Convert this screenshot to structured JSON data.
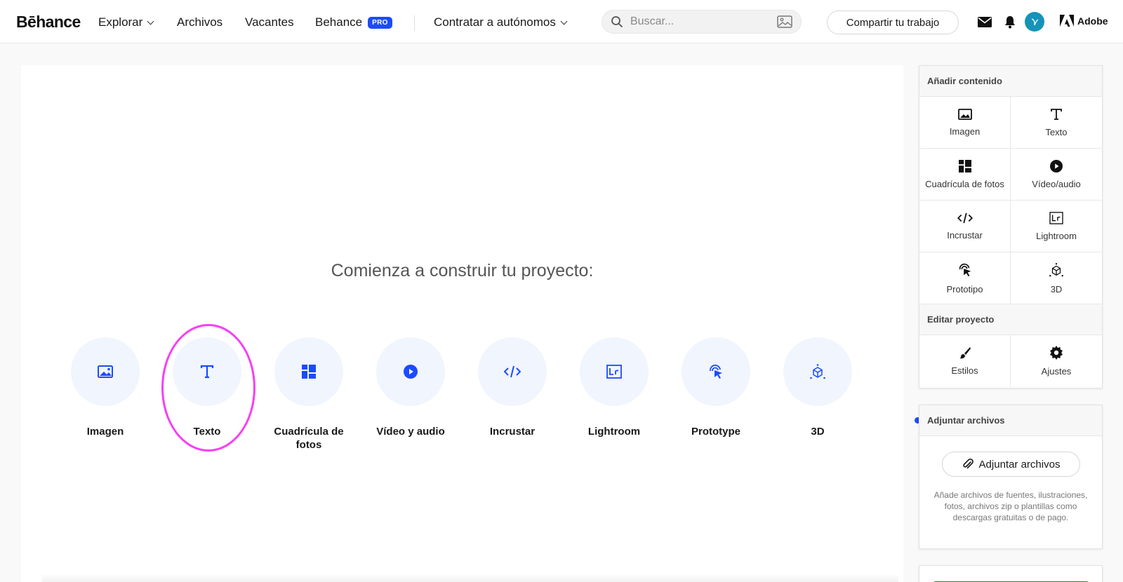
{
  "nav": {
    "logo": "Bēhance",
    "explore": "Explorar",
    "files": "Archivos",
    "jobs": "Vacantes",
    "behance": "Behance",
    "pro_badge": "PRO",
    "hire": "Contratar a autónomos",
    "search_placeholder": "Buscar...",
    "share": "Compartir tu trabajo",
    "adobe": "Adobe"
  },
  "canvas": {
    "title": "Comienza a construir tu proyecto:",
    "tools": [
      {
        "label": "Imagen",
        "icon": "image-icon"
      },
      {
        "label": "Texto",
        "icon": "text-icon"
      },
      {
        "label": "Cuadrícula de fotos",
        "icon": "photo-grid-icon"
      },
      {
        "label": "Vídeo y audio",
        "icon": "play-icon"
      },
      {
        "label": "Incrustar",
        "icon": "code-icon"
      },
      {
        "label": "Lightroom",
        "icon": "lightroom-icon"
      },
      {
        "label": "Prototype",
        "icon": "prototype-icon"
      },
      {
        "label": "3D",
        "icon": "cube-icon"
      }
    ],
    "highlighted_tool": "Texto"
  },
  "panel": {
    "add_header": "Añadir contenido",
    "add_items": [
      {
        "label": "Imagen",
        "icon": "image-icon"
      },
      {
        "label": "Texto",
        "icon": "text-icon"
      },
      {
        "label": "Cuadrícula de fotos",
        "icon": "photo-grid-icon"
      },
      {
        "label": "Vídeo/audio",
        "icon": "play-icon"
      },
      {
        "label": "Incrustar",
        "icon": "code-icon"
      },
      {
        "label": "Lightroom",
        "icon": "lightroom-icon"
      },
      {
        "label": "Prototipo",
        "icon": "prototype-icon"
      },
      {
        "label": "3D",
        "icon": "cube-icon"
      }
    ],
    "edit_header": "Editar proyecto",
    "edit_items": [
      {
        "label": "Estilos",
        "icon": "brush-icon"
      },
      {
        "label": "Ajustes",
        "icon": "gear-icon"
      }
    ],
    "attach_header": "Adjuntar archivos",
    "attach_button": "Adjuntar archivos",
    "attach_desc": "Añade archivos de fuentes, ilustraciones, fotos, archivos zip o plantillas como descargas gratuitas o de pago."
  },
  "colors": {
    "accent": "#1a4bff",
    "tool_bg": "#f1f5fd",
    "highlight": "#f83ff2",
    "green": "#1b8a2e"
  }
}
